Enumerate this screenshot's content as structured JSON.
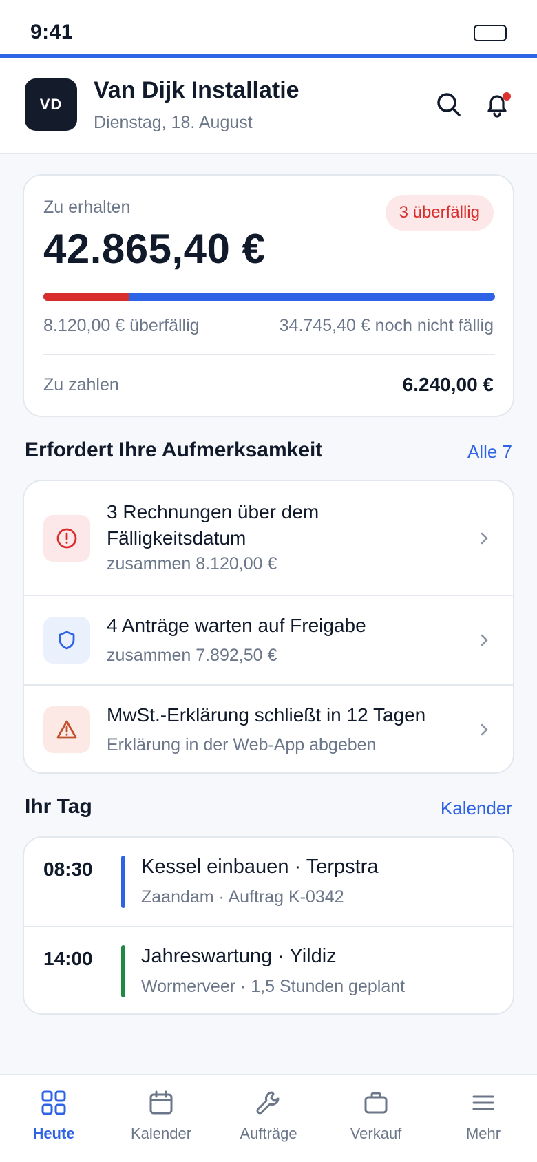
{
  "status_bar": {
    "time": "9:41"
  },
  "header": {
    "avatar_initials": "VD",
    "company": "Van Dijk Installatie",
    "date": "Dienstag, 18. August",
    "notification_dot": true
  },
  "summary": {
    "receivable_label": "Zu erhalten",
    "receivable_amount": "42.865,40 €",
    "overdue_badge": "3 überfällig",
    "overdue_fraction": 0.19,
    "overdue_amount_label": "8.120,00 € überfällig",
    "not_due_label": "34.745,40 € noch nicht fällig",
    "payable_label": "Zu zahlen",
    "payable_amount": "6.240,00 €"
  },
  "attention": {
    "title": "Erfordert Ihre Aufmerksamkeit",
    "link": "Alle 7",
    "items": [
      {
        "icon": "alert-circle-icon",
        "title": "3 Rechnungen über dem Fälligkeitsdatum",
        "sub": "zusammen 8.120,00 €"
      },
      {
        "icon": "shield-icon",
        "title": "4 Anträge warten auf Freigabe",
        "sub": "zusammen 7.892,50 €"
      },
      {
        "icon": "warning-triangle-icon",
        "title": "MwSt.-Erklärung schließt in 12 Tagen",
        "sub": "Erklärung in der Web-App abgeben"
      }
    ]
  },
  "day": {
    "title": "Ihr Tag",
    "link": "Kalender",
    "events": [
      {
        "time": "08:30",
        "title": "Kessel einbauen · Terpstra",
        "sub": "Zaandam · Auftrag K-0342",
        "color": "#2f63e6"
      },
      {
        "time": "14:00",
        "title": "Jahreswartung · Yildiz",
        "sub": "Wormerveer · 1,5 Stunden geplant",
        "color": "#1e8a44"
      }
    ]
  },
  "nav": [
    {
      "label": "Heute",
      "icon": "grid-icon",
      "active": true
    },
    {
      "label": "Kalender",
      "icon": "calendar-icon",
      "active": false
    },
    {
      "label": "Aufträge",
      "icon": "wrench-icon",
      "active": false
    },
    {
      "label": "Verkauf",
      "icon": "briefcase-icon",
      "active": false
    },
    {
      "label": "Mehr",
      "icon": "menu-icon",
      "active": false
    }
  ],
  "colors": {
    "accent": "#2f63e6",
    "danger": "#d92d2d",
    "success": "#1e8a44",
    "text": "#111a2b",
    "muted": "#6b7689"
  }
}
